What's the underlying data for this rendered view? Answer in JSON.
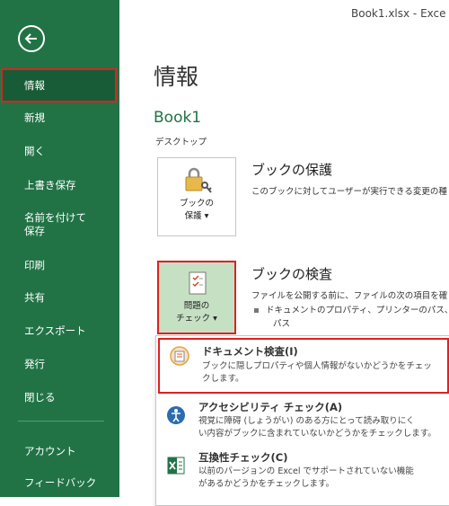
{
  "window": {
    "title": "Book1.xlsx  -  Exce"
  },
  "sidebar": {
    "items": [
      {
        "label": "情報"
      },
      {
        "label": "新規"
      },
      {
        "label": "開く"
      },
      {
        "label": "上書き保存"
      },
      {
        "label": "名前を付けて保存"
      },
      {
        "label": "印刷"
      },
      {
        "label": "共有"
      },
      {
        "label": "エクスポート"
      },
      {
        "label": "発行"
      },
      {
        "label": "閉じる"
      },
      {
        "label": "アカウント"
      },
      {
        "label": "フィードバック"
      }
    ]
  },
  "main": {
    "title": "情報",
    "book_name": "Book1",
    "book_location": "デスクトップ",
    "protect": {
      "tile_label_1": "ブックの",
      "tile_label_2": "保護 ▾",
      "title": "ブックの保護",
      "desc": "このブックに対してユーザーが実行できる変更の種"
    },
    "inspect": {
      "tile_label_1": "問題の",
      "tile_label_2": "チェック ▾",
      "title": "ブックの検査",
      "desc": "ファイルを公開する前に、ファイルの次の項目を確",
      "bullet": "ドキュメントのプロパティ、プリンターのパス、作",
      "bullet_cont": "パス"
    }
  },
  "menu": {
    "items": [
      {
        "title": "ドキュメント検査(I)",
        "desc_1": "ブックに隠しプロパティや個人情報がないかどうかをチェッ",
        "desc_2": "クします。"
      },
      {
        "title": "アクセシビリティ チェック(A)",
        "desc_1": "視覚に障碍 (しょうがい) のある方にとって読み取りにく",
        "desc_2": "い内容がブックに含まれていないかどうかをチェックします。"
      },
      {
        "title": "互換性チェック(C)",
        "desc_1": "以前のバージョンの Excel でサポートされていない機能",
        "desc_2": "があるかどうかをチェックします。"
      }
    ]
  },
  "colors": {
    "excel_green": "#217346",
    "highlight_red": "#e02020",
    "tile_selected": "#c6e0c4"
  }
}
